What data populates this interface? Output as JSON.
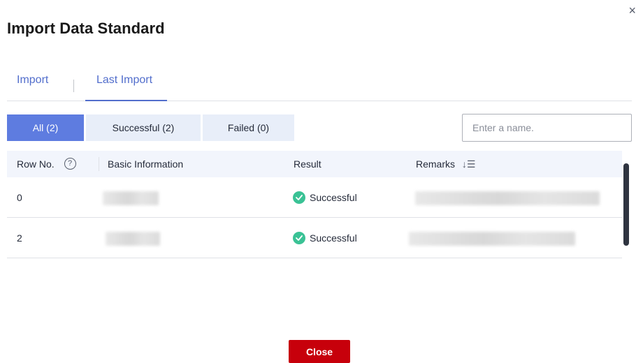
{
  "dialog": {
    "title": "Import Data Standard",
    "close_glyph": "×"
  },
  "tabs": [
    {
      "label": "Import",
      "active": false
    },
    {
      "label": "Last Import",
      "active": true
    }
  ],
  "filters": {
    "all": "All (2)",
    "successful": "Successful (2)",
    "failed": "Failed (0)"
  },
  "search": {
    "placeholder": "Enter a name.",
    "value": ""
  },
  "table": {
    "columns": {
      "row_no": "Row No.",
      "basic_info": "Basic Information",
      "result": "Result",
      "remarks": "Remarks"
    },
    "rows": [
      {
        "row_no": "0",
        "result": "Successful"
      },
      {
        "row_no": "2",
        "result": "Successful"
      }
    ]
  },
  "footer": {
    "close_label": "Close"
  },
  "colors": {
    "accent": "#5e7ce0",
    "tab_text": "#526ecc",
    "success": "#3ac295",
    "close_button": "#c7000b"
  },
  "icons": {
    "help": "help-circle-icon",
    "sort": "sort-icon",
    "status": "check-circle-icon",
    "close": "close-icon"
  }
}
